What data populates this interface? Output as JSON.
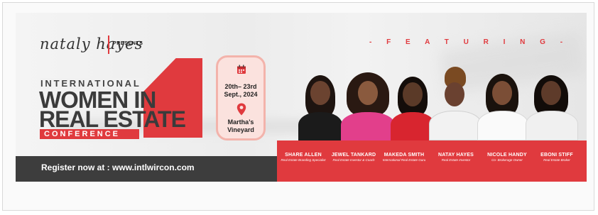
{
  "brand": {
    "logo_text": "nataly hayes",
    "presents": "PRESENTS"
  },
  "event": {
    "line1": "INTERNATIONAL",
    "line2": "WOMEN IN",
    "line3": "REAL ESTATE",
    "line4": "CONFERENCE",
    "dates": "20th– 23rd Sept., 2024",
    "venue": "Martha’s Vineyard"
  },
  "featuring_label": "- F E A T U R I N G -",
  "register": "Register now at : www.intlwircon.com",
  "speakers": [
    {
      "name": "SHARE ALLEN",
      "role": "Real Estate Branding Specialist"
    },
    {
      "name": "JEWEL TANKARD",
      "role": "Real Estate Investor & Coach"
    },
    {
      "name": "MAKEDA SMITH",
      "role": "International Real Estate Guru"
    },
    {
      "name": "NATAY HAYES",
      "role": "Real Estate Investor"
    },
    {
      "name": "NICOLE HANDY",
      "role": "Co- Brokerage Owner"
    },
    {
      "name": "EBONI STIFF",
      "role": "Real Estate Broker"
    }
  ],
  "colors": {
    "accent": "#e03a3e",
    "dark": "#3d3d3d",
    "date_bg": "#fbe2de"
  },
  "icons": [
    "calendar-icon",
    "location-pin-icon"
  ]
}
